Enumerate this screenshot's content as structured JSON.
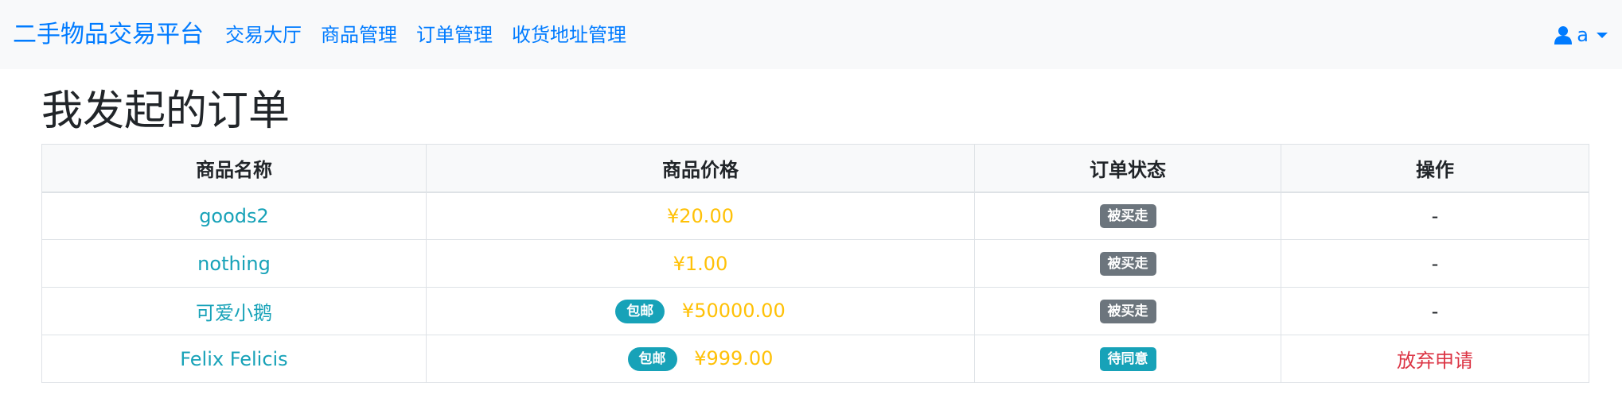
{
  "navbar": {
    "brand": "二手物品交易平台",
    "links": [
      "交易大厅",
      "商品管理",
      "订单管理",
      "收货地址管理"
    ],
    "user": "a"
  },
  "page": {
    "title": "我发起的订单"
  },
  "table": {
    "headers": [
      "商品名称",
      "商品价格",
      "订单状态",
      "操作"
    ],
    "rows": [
      {
        "name": "goods2",
        "free_shipping": "",
        "price": "¥20.00",
        "status": "被买走",
        "action": "-"
      },
      {
        "name": "nothing",
        "free_shipping": "",
        "price": "¥1.00",
        "status": "被买走",
        "action": "-"
      },
      {
        "name": "可爱小鹅",
        "free_shipping": "包邮",
        "price": "¥50000.00",
        "status": "被买走",
        "action": "-"
      },
      {
        "name": "Felix Felicis",
        "free_shipping": "包邮",
        "price": "¥999.00",
        "status": "待同意",
        "action": "放弃申请"
      }
    ]
  },
  "icons": {
    "user": "user-icon",
    "caret": "caret-down-icon"
  },
  "colors": {
    "primary": "#007bff",
    "info": "#17a2b8",
    "warning": "#ffc107",
    "secondary": "#6c757d",
    "danger": "#dc3545"
  }
}
